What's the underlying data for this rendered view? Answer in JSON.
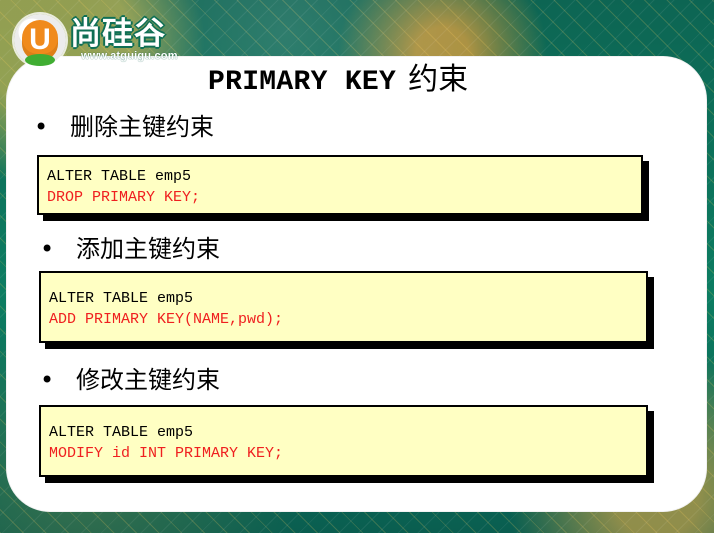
{
  "brand": {
    "logo_letter": "U",
    "name": "尚硅谷",
    "url": "www.atguigu.com"
  },
  "slide": {
    "title_en": "PRIMARY KEY",
    "title_zh": "约束"
  },
  "sections": [
    {
      "bullet_symbol": "•",
      "label": "删除主键约束",
      "code_lines": [
        "ALTER TABLE emp5",
        "DROP PRIMARY KEY;"
      ]
    },
    {
      "bullet_symbol": "•",
      "label": "添加主键约束",
      "code_lines": [
        "ALTER TABLE emp5",
        "ADD PRIMARY KEY(NAME,pwd);"
      ]
    },
    {
      "bullet_symbol": "•",
      "label": "修改主键约束",
      "code_lines": [
        "ALTER TABLE emp5",
        "MODIFY id INT PRIMARY KEY;"
      ]
    }
  ],
  "colors": {
    "panel": "#ffffff",
    "code_background": "#ffffc3",
    "code_border": "#000000",
    "code_highlight": "#ef1f1f",
    "logo_orange": "#f08a1c",
    "logo_green": "#40ad32",
    "frame_green": "#0d7d62",
    "frame_orange": "#ffb446"
  }
}
